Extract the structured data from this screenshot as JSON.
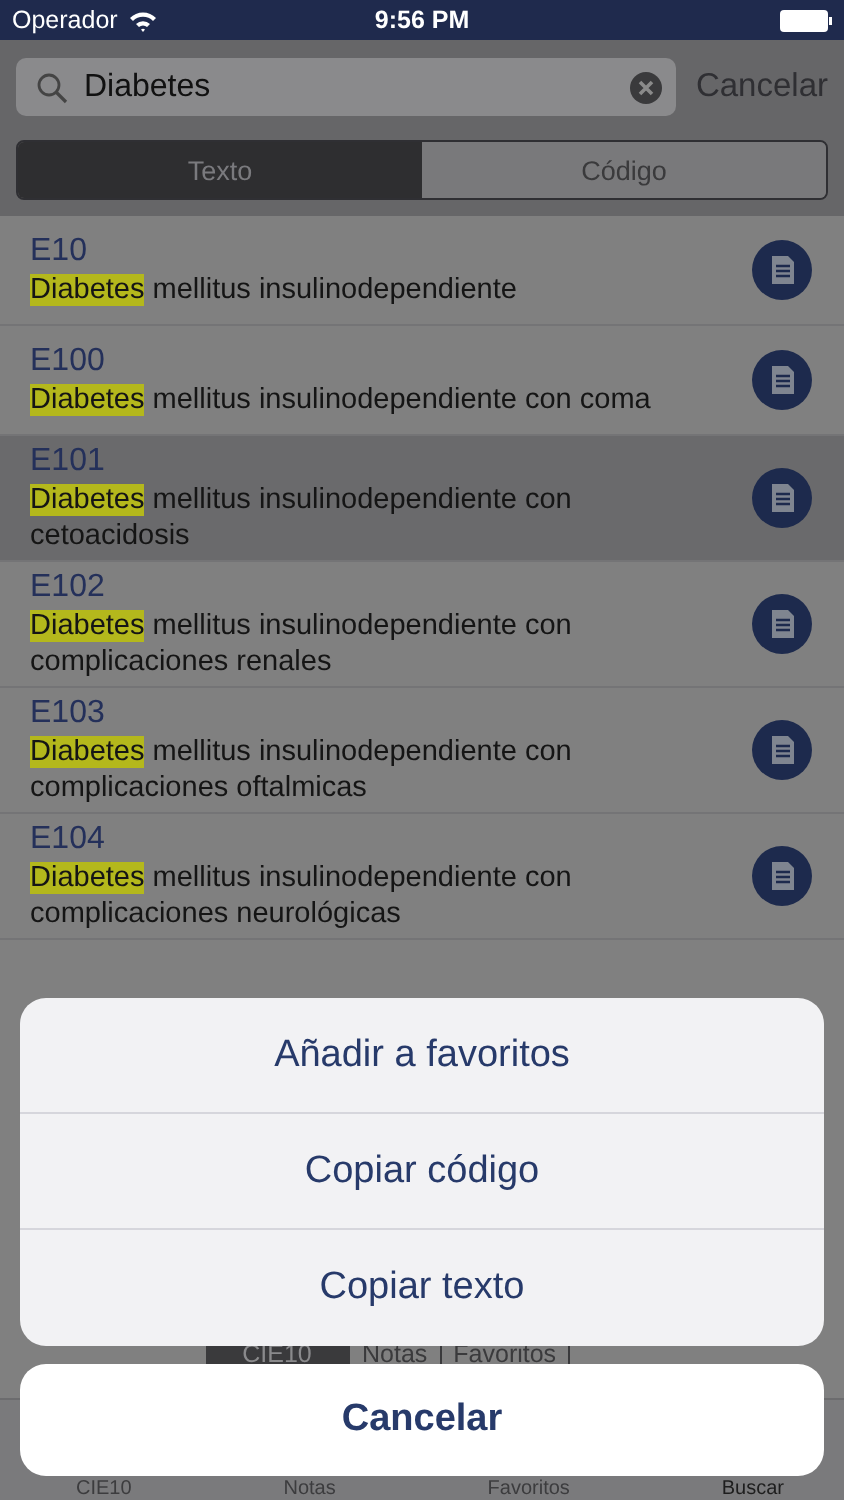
{
  "status_bar": {
    "carrier": "Operador",
    "time": "9:56 PM"
  },
  "search": {
    "value": "Diabetes",
    "cancel": "Cancelar"
  },
  "segments": [
    {
      "label": "Texto",
      "selected": true
    },
    {
      "label": "Código",
      "selected": false
    }
  ],
  "results": [
    {
      "code": "E10",
      "term": "Diabetes",
      "description": "mellitus insulinodependiente",
      "selected": false
    },
    {
      "code": "E100",
      "term": "Diabetes",
      "description": "mellitus insulinodependiente con coma",
      "selected": false
    },
    {
      "code": "E101",
      "term": "Diabetes",
      "description": "mellitus insulinodependiente con cetoacidosis",
      "selected": true
    },
    {
      "code": "E102",
      "term": "Diabetes",
      "description": "mellitus insulinodependiente con complicaciones renales",
      "selected": false
    },
    {
      "code": "E103",
      "term": "Diabetes",
      "description": "mellitus insulinodependiente con complicaciones oftalmicas",
      "selected": false
    },
    {
      "code": "E104",
      "term": "Diabetes",
      "description": "mellitus insulinodependiente con complicaciones neurológicas",
      "selected": false
    }
  ],
  "bottom_segments": [
    {
      "label": "CIE10",
      "selected": true
    },
    {
      "label": "Notas",
      "selected": false
    },
    {
      "label": "Favoritos",
      "selected": false
    }
  ],
  "tab_bar": [
    {
      "label": "CIE10",
      "selected": false
    },
    {
      "label": "Notas",
      "selected": false
    },
    {
      "label": "Favoritos",
      "selected": false
    },
    {
      "label": "Buscar",
      "selected": true
    }
  ],
  "action_sheet": {
    "actions": [
      "Añadir a favoritos",
      "Copiar código",
      "Copiar texto"
    ],
    "cancel": "Cancelar"
  }
}
